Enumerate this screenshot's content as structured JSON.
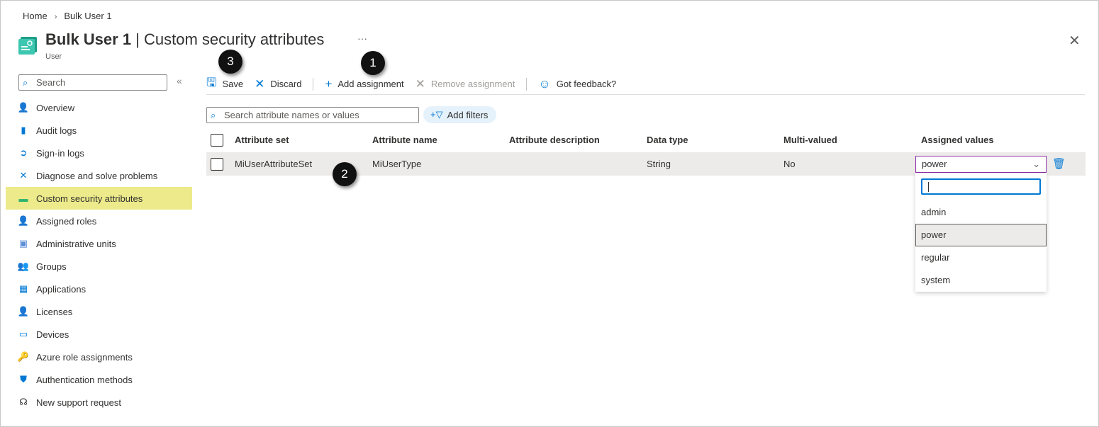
{
  "breadcrumb": {
    "home": "Home",
    "current": "Bulk User 1"
  },
  "header": {
    "title_bold": "Bulk User 1",
    "title_rest": " | Custom security attributes",
    "subtitle": "User",
    "more": "···",
    "close": "✕"
  },
  "sidebar": {
    "search_placeholder": "Search",
    "collapse": "«",
    "items": [
      {
        "label": "Overview",
        "icon": "👤",
        "color": "#2b88d8"
      },
      {
        "label": "Audit logs",
        "icon": "▮",
        "color": "#0078d4"
      },
      {
        "label": "Sign-in logs",
        "icon": "➲",
        "color": "#0078d4"
      },
      {
        "label": "Diagnose and solve problems",
        "icon": "✕",
        "color": "#0078d4"
      },
      {
        "label": "Custom security attributes",
        "icon": "▬",
        "color": "#2fb36e",
        "active": true
      },
      {
        "label": "Assigned roles",
        "icon": "👤",
        "color": "#5ea72f"
      },
      {
        "label": "Administrative units",
        "icon": "▣",
        "color": "#5b8ed6"
      },
      {
        "label": "Groups",
        "icon": "👥",
        "color": "#2b88d8"
      },
      {
        "label": "Applications",
        "icon": "▦",
        "color": "#0078d4"
      },
      {
        "label": "Licenses",
        "icon": "👤",
        "color": "#6aa0d6"
      },
      {
        "label": "Devices",
        "icon": "▭",
        "color": "#0078d4"
      },
      {
        "label": "Azure role assignments",
        "icon": "🔑",
        "color": "#f2c200"
      },
      {
        "label": "Authentication methods",
        "icon": "⛊",
        "color": "#0078d4"
      },
      {
        "label": "New support request",
        "icon": "☊",
        "color": "#323130"
      }
    ]
  },
  "toolbar": {
    "save": "Save",
    "discard": "Discard",
    "add": "Add assignment",
    "remove": "Remove assignment",
    "feedback": "Got feedback?"
  },
  "filter": {
    "search_placeholder": "Search attribute names or values",
    "add_filters": "Add filters"
  },
  "table": {
    "headers": [
      "Attribute set",
      "Attribute name",
      "Attribute description",
      "Data type",
      "Multi-valued",
      "Assigned values"
    ],
    "row": {
      "set": "MiUserAttributeSet",
      "name": "MiUserType",
      "description": "",
      "type": "String",
      "multi": "No",
      "value": "power"
    }
  },
  "dropdown": {
    "search": "",
    "options": [
      "admin",
      "power",
      "regular",
      "system"
    ],
    "selected": "power"
  },
  "callouts": [
    "1",
    "2",
    "3"
  ]
}
